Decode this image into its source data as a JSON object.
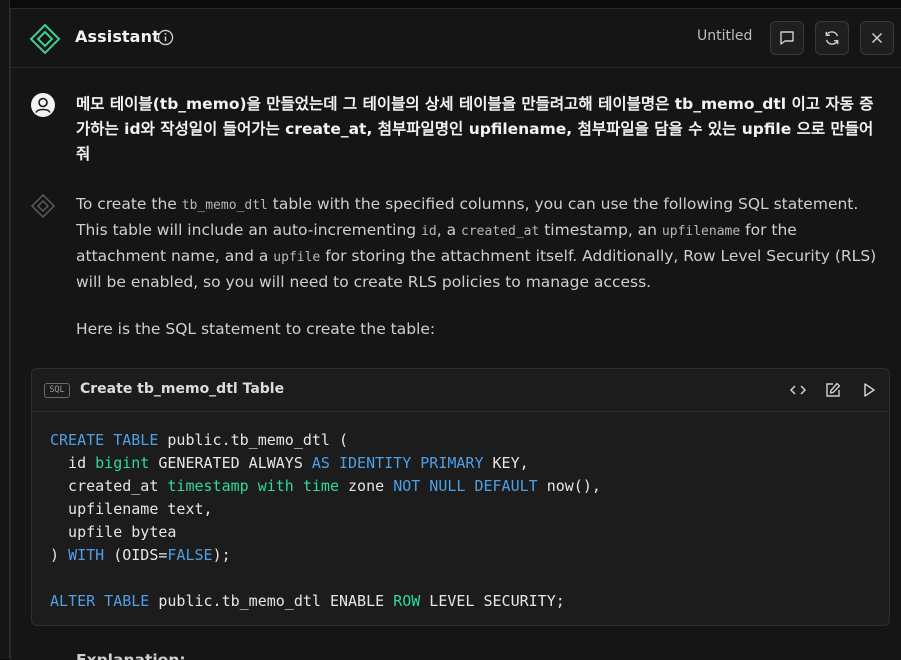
{
  "header": {
    "title": "Assistant",
    "doc_name": "Untitled",
    "buttons": [
      "chat",
      "refresh",
      "close"
    ]
  },
  "messages": {
    "user_text": "메모 테이블(tb_memo)을 만들었는데 그 테이블의 상세 테이블을 만들려고해 테이블명은 tb_memo_dtl 이고 자동 증가하는 id와 작성일이 들어가는 create_at, 첨부파일명인 upfilename, 첨부파일을 담을 수 있는 upfile 으로 만들어줘",
    "ai_parts": {
      "p1": "To create the ",
      "c1": "tb_memo_dtl",
      "p2": " table with the specified columns, you can use the following SQL statement. This table will include an auto-incrementing ",
      "c2": "id",
      "p3": ", a ",
      "c3": "created_at",
      "p4": " timestamp, an ",
      "c4": "upfilename",
      "p5": " for the attachment name, and a ",
      "c5": "upfile",
      "p6": " for storing the attachment itself. Additionally, Row Level Security (RLS) will be enabled, so you will need to create RLS policies to manage access."
    },
    "ai_text2": "Here is the SQL statement to create the table:",
    "trailing_text": "Explanation:"
  },
  "code_block": {
    "icon_label": "SQL",
    "title": "Create tb_memo_dtl Table",
    "tokens": {
      "l1a": "CREATE TABLE",
      "l1b": " public.tb_memo_dtl (",
      "l2a": "  id ",
      "l2b": "bigint",
      "l2c": " GENERATED ALWAYS ",
      "l2d": "AS IDENTITY PRIMARY",
      "l2e": " KEY,",
      "l3a": "  created_at ",
      "l3b": "timestamp with time",
      "l3c": " zone ",
      "l3d": "NOT NULL DEFAULT",
      "l3e": " now(),",
      "l4": "  upfilename text,",
      "l5": "  upfile bytea",
      "l6a": ") ",
      "l6b": "WITH",
      "l6c": " (OIDS=",
      "l6d": "FALSE",
      "l6e": ");",
      "l8a": "ALTER TABLE",
      "l8b": " public.tb_memo_dtl ENABLE ",
      "l8c": "ROW",
      "l8d": " LEVEL SECURITY;"
    }
  },
  "colors": {
    "keyword": "#4f9fe6",
    "type": "#2bd9a4",
    "accent": "#3ecf8e"
  }
}
